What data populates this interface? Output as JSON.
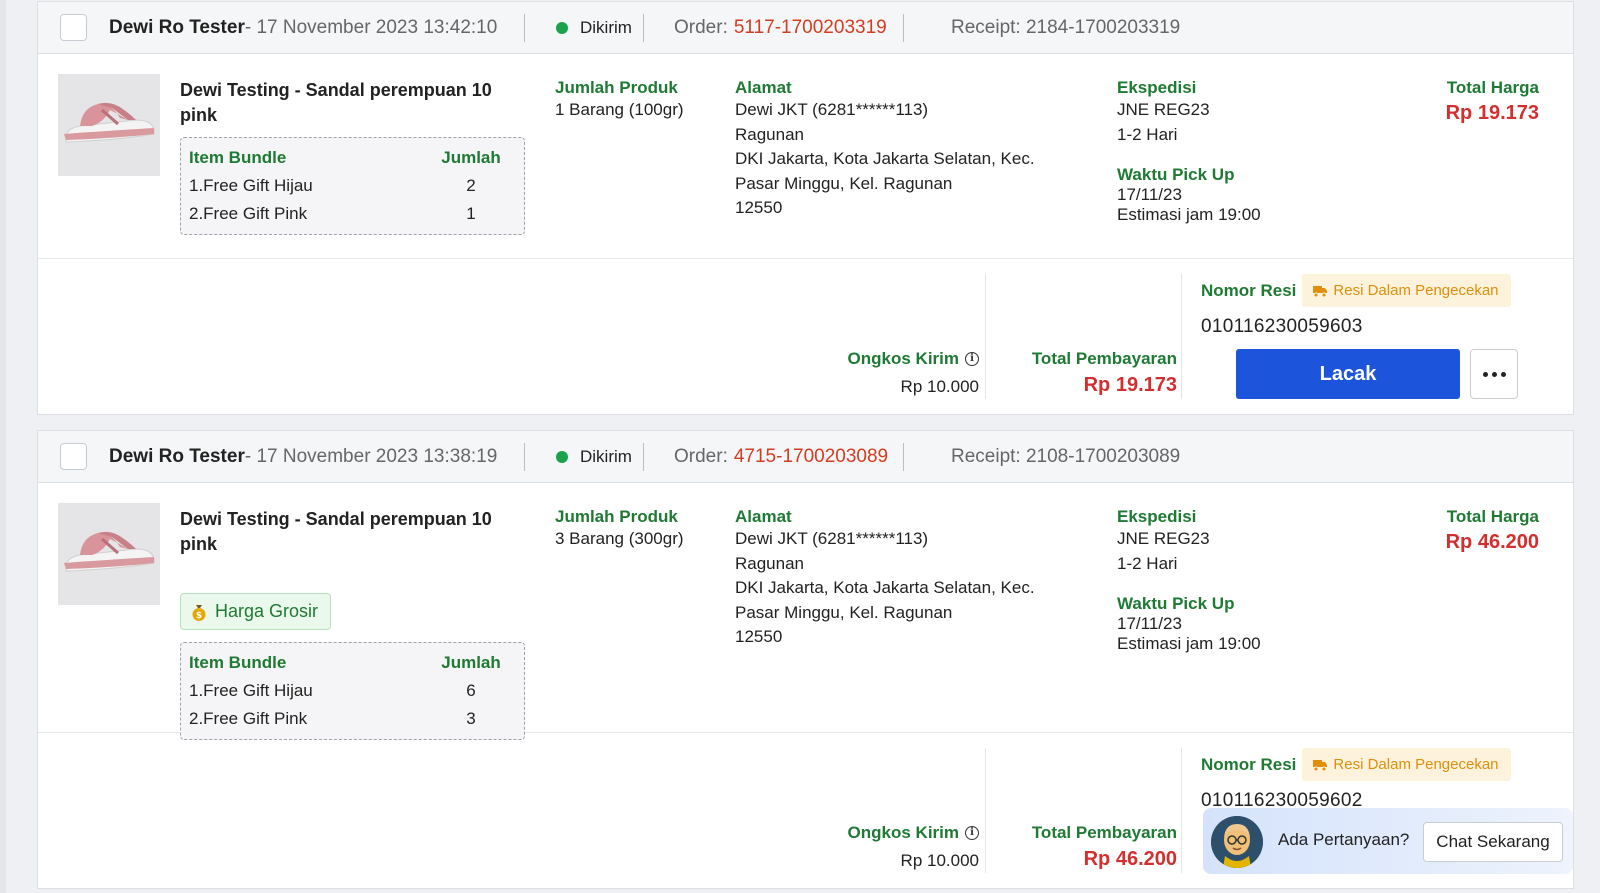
{
  "orders": [
    {
      "buyer": "Dewi Ro Tester",
      "date": " - 17 November 2023 13:42:10",
      "status": "Dikirim",
      "order_label": "Order:",
      "order_no": "5117-1700203319",
      "receipt": "Receipt: 2184-1700203319",
      "product_name": "Dewi Testing - Sandal perempuan 10 pink",
      "badge": "",
      "bundle_header": {
        "item": "Item Bundle",
        "qty": "Jumlah"
      },
      "bundle_items": [
        {
          "name": "1.Free Gift Hijau",
          "qty": "2"
        },
        {
          "name": "2.Free Gift Pink",
          "qty": "1"
        }
      ],
      "jumlah_label": "Jumlah Produk",
      "jumlah_value": "1 Barang (100gr)",
      "alamat_label": "Alamat",
      "alamat_lines": [
        "Dewi JKT (6281******113)",
        "Ragunan",
        "DKI Jakarta, Kota Jakarta Selatan, Kec.",
        "Pasar Minggu, Kel. Ragunan",
        "12550"
      ],
      "ekspedisi_label": "Ekspedisi",
      "ekspedisi_service": "JNE REG23",
      "ekspedisi_eta": "1-2 Hari",
      "pickup_label": "Waktu Pick Up",
      "pickup_date": "17/11/23",
      "pickup_time": "Estimasi jam 19:00",
      "total_harga_label": "Total Harga",
      "total_harga": "Rp 19.173",
      "ongkos_label": "Ongkos Kirim",
      "ongkos_value": "Rp 10.000",
      "total_bayar_label": "Total Pembayaran",
      "total_bayar": "Rp 19.173",
      "resi_label": "Nomor Resi",
      "resi_badge": "Resi Dalam Pengecekan",
      "resi_number": "010116230059603",
      "lacak_label": "Lacak"
    },
    {
      "buyer": "Dewi Ro Tester",
      "date": " - 17 November 2023 13:38:19",
      "status": "Dikirim",
      "order_label": "Order:",
      "order_no": "4715-1700203089",
      "receipt": "Receipt: 2108-1700203089",
      "product_name": "Dewi Testing - Sandal perempuan 10 pink",
      "badge": "Harga Grosir",
      "bundle_header": {
        "item": "Item Bundle",
        "qty": "Jumlah"
      },
      "bundle_items": [
        {
          "name": "1.Free Gift Hijau",
          "qty": "6"
        },
        {
          "name": "2.Free Gift Pink",
          "qty": "3"
        }
      ],
      "jumlah_label": "Jumlah Produk",
      "jumlah_value": "3 Barang (300gr)",
      "alamat_label": "Alamat",
      "alamat_lines": [
        "Dewi JKT (6281******113)",
        "Ragunan",
        "DKI Jakarta, Kota Jakarta Selatan, Kec.",
        "Pasar Minggu, Kel. Ragunan",
        "12550"
      ],
      "ekspedisi_label": "Ekspedisi",
      "ekspedisi_service": "JNE REG23",
      "ekspedisi_eta": "1-2 Hari",
      "pickup_label": "Waktu Pick Up",
      "pickup_date": "17/11/23",
      "pickup_time": "Estimasi jam 19:00",
      "total_harga_label": "Total Harga",
      "total_harga": "Rp 46.200",
      "ongkos_label": "Ongkos Kirim",
      "ongkos_value": "Rp 10.000",
      "total_bayar_label": "Total Pembayaran",
      "total_bayar": "Rp 46.200",
      "resi_label": "Nomor Resi",
      "resi_badge": "Resi Dalam Pengecekan",
      "resi_number": "010116230059602",
      "lacak_label": "Lacak"
    }
  ],
  "chat": {
    "question": "Ada Pertanyaan?",
    "button": "Chat Sekarang"
  },
  "icons": {
    "status_dot": "status-dot-icon",
    "info": "info-icon",
    "truck": "truck-icon",
    "money_bag": "money-bag-icon",
    "more": "more-dots-icon"
  },
  "colors": {
    "accent_green": "#1f7a34",
    "price_red": "#d32f2f",
    "order_red": "#d43c1f",
    "button_blue": "#1c55db",
    "status_green": "#1aa34a",
    "resi_badge_orange": "#e08e0b"
  }
}
